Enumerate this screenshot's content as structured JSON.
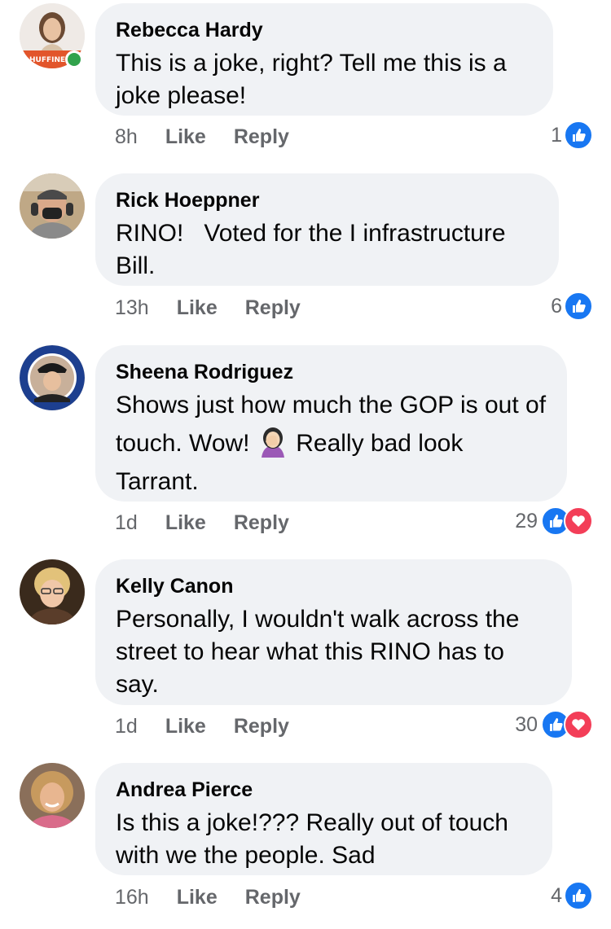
{
  "colors": {
    "bubble": "#f0f2f5",
    "meta": "#65676b",
    "like": "#1877f2",
    "love": "#f33e58",
    "online": "#31a24c"
  },
  "comments": [
    {
      "name": "Rebecca Hardy",
      "text": "This is a joke, right? Tell me this is a joke please!",
      "time": "8h",
      "like_label": "Like",
      "reply_label": "Reply",
      "reaction_count": "1",
      "reactions": [
        "like-icon"
      ],
      "avatar_badge_text": "HUFFINE"
    },
    {
      "name": "Rick Hoeppner",
      "text": "RINO!   Voted for the I infrastructure Bill.",
      "time": "13h",
      "like_label": "Like",
      "reply_label": "Reply",
      "reaction_count": "6",
      "reactions": [
        "like-icon"
      ]
    },
    {
      "name": "Sheena Rodriguez",
      "text_before_emoji": "Shows just how much the GOP is out of touch. Wow!",
      "text_after_emoji": "Really bad look Tarrant.",
      "emoji": "woman-facepalming-emoji",
      "time": "1d",
      "like_label": "Like",
      "reply_label": "Reply",
      "reaction_count": "29",
      "reactions": [
        "like-icon",
        "love-icon"
      ]
    },
    {
      "name": "Kelly Canon",
      "text": "Personally, I wouldn't walk across the street to hear what this RINO has to say.",
      "time": "1d",
      "like_label": "Like",
      "reply_label": "Reply",
      "reaction_count": "30",
      "reactions": [
        "like-icon",
        "love-icon"
      ]
    },
    {
      "name": "Andrea Pierce",
      "text": "Is this a joke!??? Really out of touch with we the people. Sad",
      "time": "16h",
      "like_label": "Like",
      "reply_label": "Reply",
      "reaction_count": "4",
      "reactions": [
        "like-icon"
      ]
    }
  ]
}
